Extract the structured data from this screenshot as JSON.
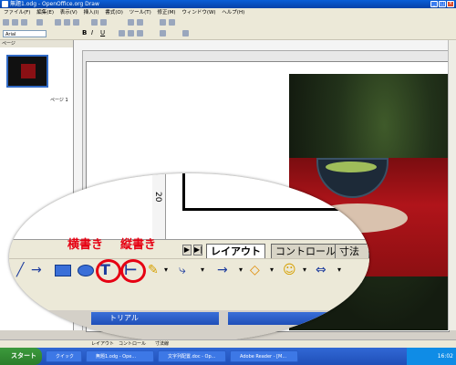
{
  "window": {
    "title": "無題1.odg - OpenOffice.org Draw"
  },
  "menu": [
    "ファイル(F)",
    "編集(E)",
    "表示(V)",
    "挿入(I)",
    "書式(O)",
    "ツール(T)",
    "修正(M)",
    "ウィンドウ(W)",
    "ヘルプ(H)"
  ],
  "toolbar": {
    "font_value": "Arial"
  },
  "pages_panel": {
    "header": "ページ",
    "thumb_label": "ページ 1"
  },
  "zoom": {
    "ruler_mark": "20",
    "tabs": [
      "レイアウト",
      "コントロール",
      "寸法線"
    ],
    "nav": [
      "▶",
      "▶|"
    ],
    "label_horizontal": "横書き",
    "label_vertical": "縦書き",
    "tool_text_glyph": "T",
    "tool_vertical_glyph": "⊢",
    "lower_tabs": [
      "トリアル"
    ]
  },
  "status": {
    "tabs": [
      "レイアウト",
      "コントロール",
      "寸法線"
    ]
  },
  "taskbar": {
    "start": "スタート",
    "tasks": [
      "クイック",
      "無題1.odg - Ope...",
      "文字列配置.doc - Op...",
      "Adobe Reader - [M..."
    ],
    "tray": "16:02"
  }
}
